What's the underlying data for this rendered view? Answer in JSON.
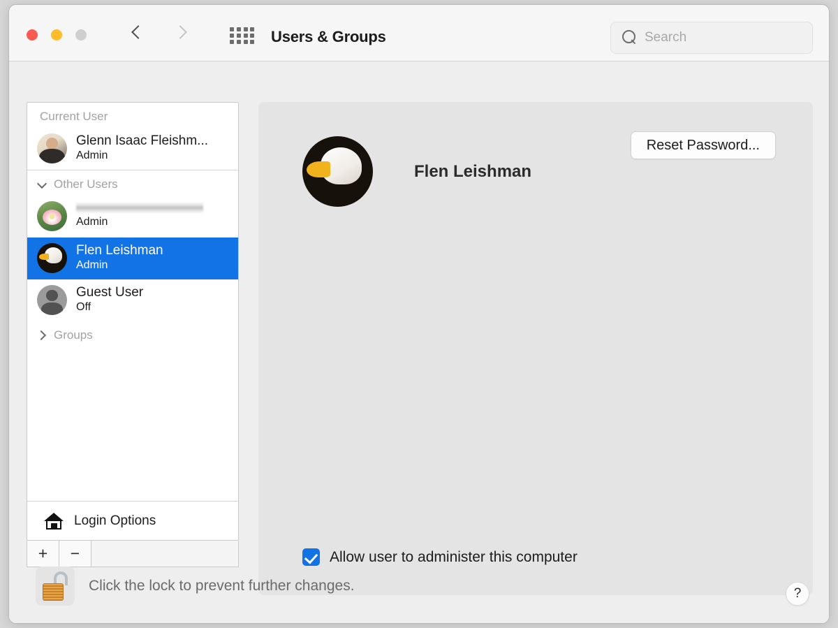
{
  "window": {
    "title": "Users & Groups",
    "traffic_lights": {
      "close": "close-button",
      "minimize": "minimize-button",
      "zoom": "zoom-button"
    },
    "nav": {
      "back": "back-chevron",
      "forward": "forward-chevron"
    },
    "show_all_icon": "grid-icon"
  },
  "search": {
    "value": "",
    "placeholder": "Search",
    "icon": "search-icon"
  },
  "sidebar": {
    "current_user_header": "Current User",
    "other_users_header": "Other Users",
    "groups_header": "Groups",
    "current_user": {
      "name": "Glenn Isaac Fleishm...",
      "role": "Admin",
      "avatar": "photo-portrait"
    },
    "other_users": [
      {
        "name": "",
        "name_redacted": true,
        "role": "Admin",
        "avatar": "lotus-flower",
        "selected": false
      },
      {
        "name": "Flen Leishman",
        "name_redacted": false,
        "role": "Admin",
        "avatar": "bald-eagle",
        "selected": true
      },
      {
        "name": "Guest User",
        "name_redacted": false,
        "role": "Off",
        "avatar": "guest-silhouette",
        "selected": false
      }
    ],
    "login_options": {
      "label": "Login Options",
      "icon": "home-icon"
    },
    "add_button": "+",
    "remove_button": "−"
  },
  "detail": {
    "user_name": "Flen Leishman",
    "avatar": "bald-eagle",
    "reset_password_label": "Reset Password...",
    "admin_checkbox": {
      "label": "Allow user to administer this computer",
      "checked": true
    }
  },
  "footer": {
    "lock_text": "Click the lock to prevent further changes.",
    "lock_icon": "unlocked-padlock-icon",
    "help_label": "?"
  },
  "colors": {
    "selection_blue": "#1273e6",
    "window_bg": "#eeeeee",
    "panel_bg": "#e4e4e4",
    "sidebar_bg": "#ffffff",
    "close_red": "#f95a52",
    "minimize_yellow": "#fcbc2c",
    "zoom_grey": "#cfcfcf"
  }
}
